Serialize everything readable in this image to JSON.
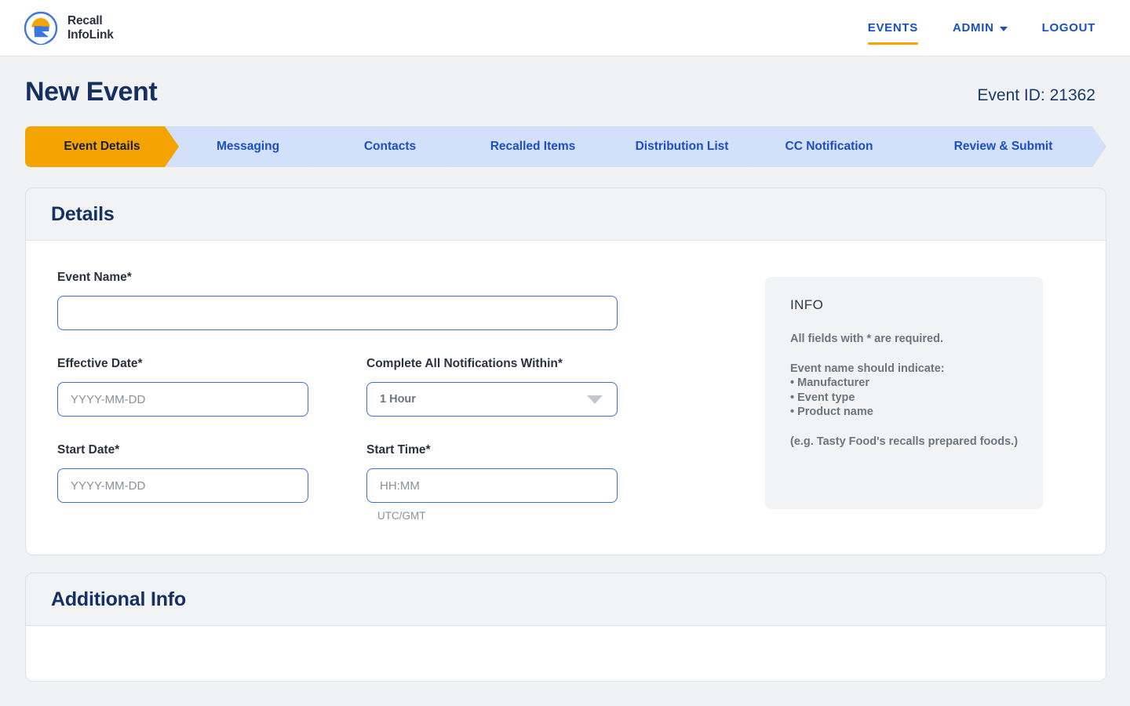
{
  "brand": {
    "line1": "Recall",
    "line2": "InfoLink",
    "logo_icon": "recall-infolink-logo",
    "colors": {
      "orange": "#f5a300",
      "blue": "#3c76e0",
      "ring": "#3c76e0"
    }
  },
  "nav": {
    "items": [
      {
        "label": "EVENTS",
        "active": true,
        "has_caret": false
      },
      {
        "label": "ADMIN",
        "active": false,
        "has_caret": true
      },
      {
        "label": "LOGOUT",
        "active": false,
        "has_caret": false
      }
    ]
  },
  "header": {
    "title": "New Event",
    "event_id_label": "Event ID: 21362"
  },
  "stepper": {
    "active_index": 0,
    "steps": [
      {
        "label": "Event Details"
      },
      {
        "label": "Messaging"
      },
      {
        "label": "Contacts"
      },
      {
        "label": "Recalled Items"
      },
      {
        "label": "Distribution List"
      },
      {
        "label": "CC Notification"
      },
      {
        "label": "Review & Submit"
      }
    ]
  },
  "details_card": {
    "title": "Details",
    "fields": {
      "event_name": {
        "label": "Event Name*",
        "value": "",
        "placeholder": ""
      },
      "effective_date": {
        "label": "Effective Date*",
        "value": "",
        "placeholder": "YYYY-MM-DD"
      },
      "complete_within": {
        "label": "Complete All Notifications Within*",
        "value": "1 Hour"
      },
      "start_date": {
        "label": "Start Date*",
        "value": "",
        "placeholder": "YYYY-MM-DD"
      },
      "start_time": {
        "label": "Start Time*",
        "value": "",
        "placeholder": "HH:MM",
        "help": "UTC/GMT"
      }
    }
  },
  "info_panel": {
    "title": "INFO",
    "required_note": "All  fields with * are required.",
    "indicate_heading": "Event name should indicate:",
    "indicate_items": [
      "Manufacturer",
      "Event type",
      "Product name"
    ],
    "example": "(e.g. Tasty Food's recalls prepared foods.)"
  },
  "additional_card": {
    "title": "Additional Info"
  }
}
